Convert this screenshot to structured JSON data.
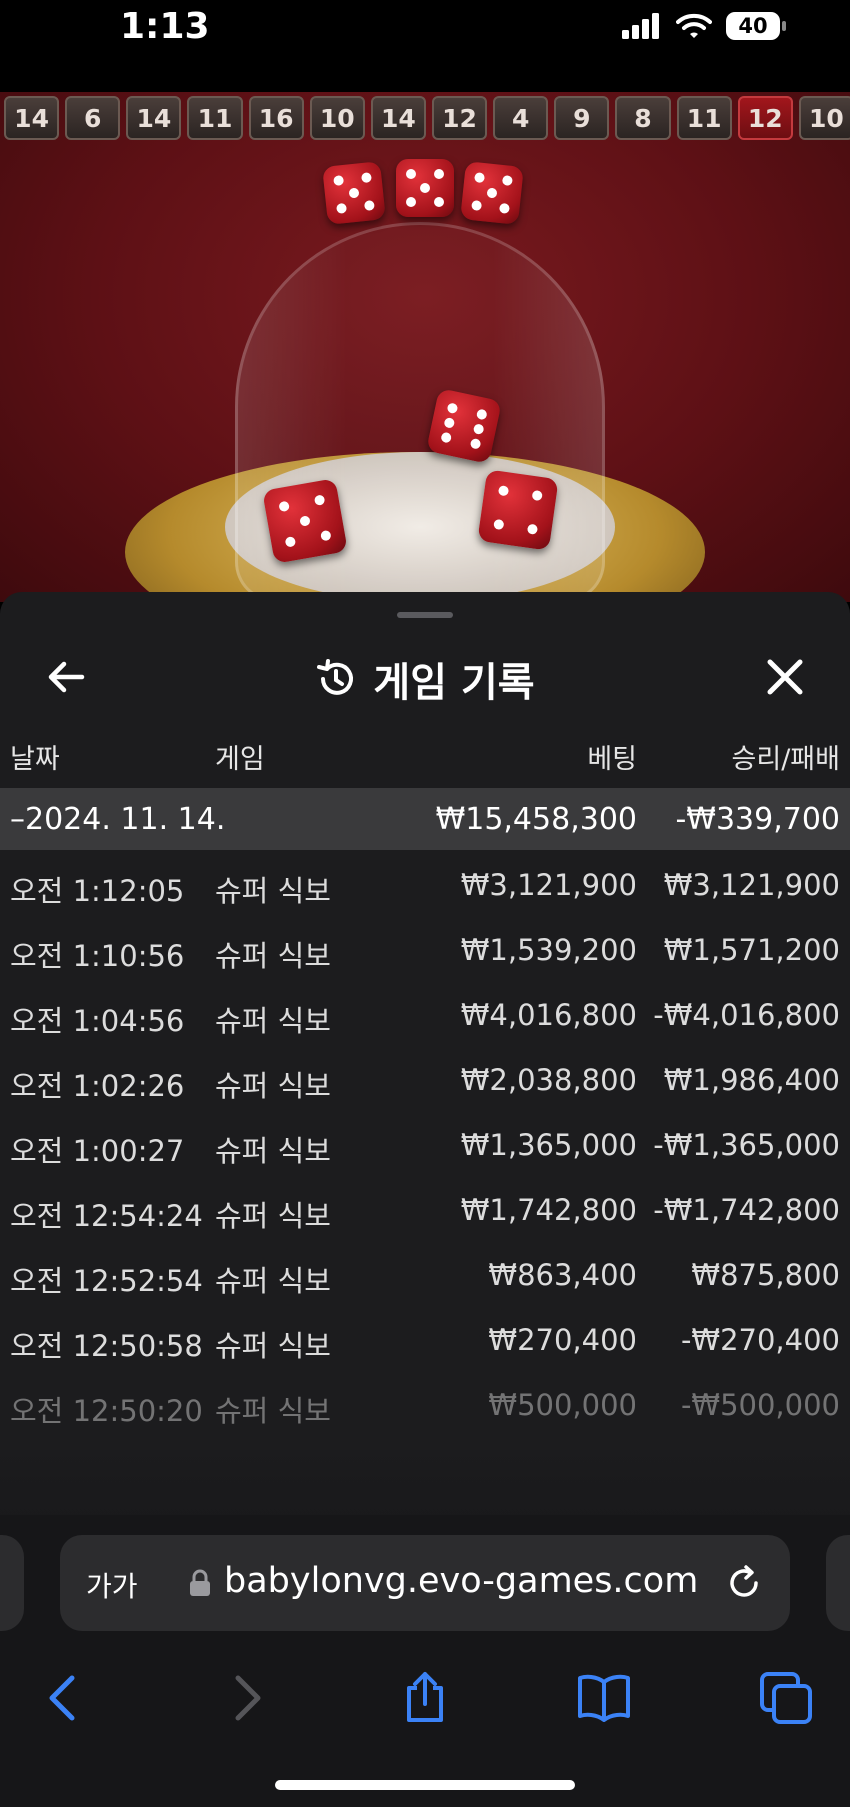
{
  "status": {
    "time": "1:13",
    "battery": "40"
  },
  "results_strip": [
    "14",
    "6",
    "14",
    "11",
    "16",
    "10",
    "14",
    "12",
    "4",
    "9",
    "8",
    "11",
    "12",
    "10"
  ],
  "panel": {
    "title": "게임 기록",
    "columns": {
      "date": "날짜",
      "game": "게임",
      "bet": "베팅",
      "winloss": "승리/패배"
    },
    "summary": {
      "date": "–2024. 11. 14.",
      "bet": "₩15,458,300",
      "winloss": "-₩339,700"
    },
    "rows": [
      {
        "time": "오전 1:12:05",
        "game": "슈퍼 식보",
        "bet": "₩3,121,900",
        "winloss": "₩3,121,900"
      },
      {
        "time": "오전 1:10:56",
        "game": "슈퍼 식보",
        "bet": "₩1,539,200",
        "winloss": "₩1,571,200"
      },
      {
        "time": "오전 1:04:56",
        "game": "슈퍼 식보",
        "bet": "₩4,016,800",
        "winloss": "-₩4,016,800"
      },
      {
        "time": "오전 1:02:26",
        "game": "슈퍼 식보",
        "bet": "₩2,038,800",
        "winloss": "₩1,986,400"
      },
      {
        "time": "오전 1:00:27",
        "game": "슈퍼 식보",
        "bet": "₩1,365,000",
        "winloss": "-₩1,365,000"
      },
      {
        "time": "오전 12:54:24",
        "game": "슈퍼 식보",
        "bet": "₩1,742,800",
        "winloss": "-₩1,742,800"
      },
      {
        "time": "오전 12:52:54",
        "game": "슈퍼 식보",
        "bet": "₩863,400",
        "winloss": "₩875,800"
      },
      {
        "time": "오전 12:50:58",
        "game": "슈퍼 식보",
        "bet": "₩270,400",
        "winloss": "-₩270,400"
      },
      {
        "time": "오전 12:50:20",
        "game": "슈퍼 식보",
        "bet": "₩500,000",
        "winloss": "-₩500,000"
      }
    ]
  },
  "browser": {
    "aa_label": "가가",
    "url": "babylonvg.evo-games.com"
  },
  "colors": {
    "accent": "#3b82f6",
    "panel_bg": "#1c1c1e",
    "summary_bg": "#3a3a3c"
  }
}
